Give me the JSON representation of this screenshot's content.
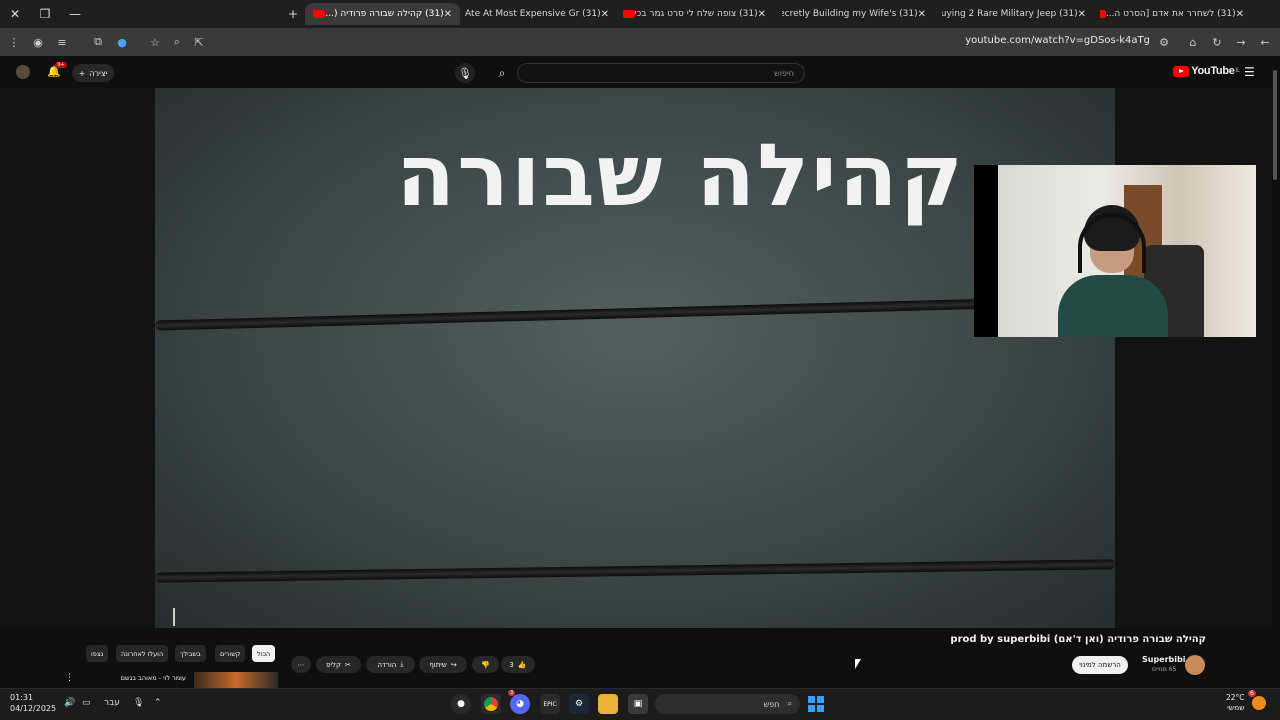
{
  "browser": {
    "tabs": [
      {
        "title": "(31) לשחרר את אדם [הסרט ה...",
        "active": false
      },
      {
        "title": "(31) Buying 2 Rare Military Jeep",
        "active": false
      },
      {
        "title": "(31) Secretly Building my Wife's",
        "active": false
      },
      {
        "title": "(31) צופה שלח לי סרט גמר בכי",
        "active": false
      },
      {
        "title": "(31) I Ate At Most Expensive Gr",
        "active": false
      },
      {
        "title": "(31) קהילה שבורה פרודיה (...",
        "active": true
      }
    ],
    "new_tab": "+",
    "url": "youtube.com/watch?v=gDSos-k4aTg"
  },
  "youtube": {
    "logo_text": "YouTube",
    "logo_country": "IL",
    "search_placeholder": "חיפוש",
    "create_label": "יצירה",
    "notif_badge": "9+"
  },
  "video": {
    "overlay_title": "קהילה שבורה"
  },
  "below_video": {
    "title": "קהילה שבורה פרודיה (ואן ד'אם) prod by superbibi",
    "channel_name": "Superbibi",
    "channel_subs": "65 מנויים",
    "subscribe_label": "הרשמה למינוי",
    "like_count": "3",
    "share_label": "שיתוף",
    "download_label": "הורדה",
    "clip_label": "קליפ",
    "more_label": "⋯"
  },
  "chips": [
    "הכול",
    "קשורים",
    "בשבילך",
    "הועלו לאחרונה",
    "נצפו"
  ],
  "recommendation": {
    "title": "עומר לוי - מאוהב בגשם"
  },
  "taskbar": {
    "time": "01:31",
    "date": "04/12/2025",
    "language": "עבר",
    "search_label": "חפש",
    "weather_temp": "22°C",
    "weather_desc": "שמשי",
    "weather_badge": "6",
    "discord_badge": "3"
  },
  "colors": {
    "accent": "#ff0000",
    "background": "#0f0f0f",
    "chip_active": "#f1f1f1"
  }
}
